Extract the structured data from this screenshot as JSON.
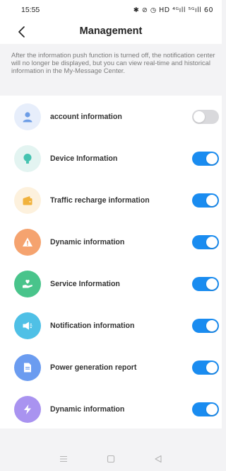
{
  "status_bar": {
    "time": "15:55",
    "icons_text": "✱ ⊘ ◷ HD ⁴ᴳıll ⁵ᴳıll 60"
  },
  "header": {
    "title": "Management",
    "back_icon": "chevron-left-icon"
  },
  "notice": "After the information push function is turned off, the notification center will no longer be displayed, but you can view real-time and historical information in the My-Message Center.",
  "items": [
    {
      "label": "account information",
      "icon": "person-icon",
      "enabled": false,
      "bg": "#e7eefb",
      "fg": "#6d9de6"
    },
    {
      "label": "Device Information",
      "icon": "bulb-icon",
      "enabled": true,
      "bg": "#e3f4f1",
      "fg": "#45c3b0"
    },
    {
      "label": "Traffic recharge information",
      "icon": "wallet-icon",
      "enabled": true,
      "bg": "#fdf1dd",
      "fg": "#f1b23c"
    },
    {
      "label": "Dynamic information",
      "icon": "alert-icon",
      "enabled": true,
      "bg": "#f5a36f",
      "fg": "#ffffff"
    },
    {
      "label": "Service Information",
      "icon": "hand-heart-icon",
      "enabled": true,
      "bg": "#49c48b",
      "fg": "#ffffff"
    },
    {
      "label": "Notification information",
      "icon": "megaphone-icon",
      "enabled": true,
      "bg": "#4fc0e6",
      "fg": "#ffffff"
    },
    {
      "label": "Power generation report",
      "icon": "document-icon",
      "enabled": true,
      "bg": "#6b9cf0",
      "fg": "#ffffff"
    },
    {
      "label": "Dynamic information",
      "icon": "bolt-icon",
      "enabled": true,
      "bg": "#a993f0",
      "fg": "#ffffff"
    }
  ],
  "colors": {
    "accent": "#1a8cf0",
    "toggle_off": "#d9d9dc"
  },
  "system_nav": [
    "menu-icon",
    "home-square-icon",
    "back-triangle-icon"
  ]
}
